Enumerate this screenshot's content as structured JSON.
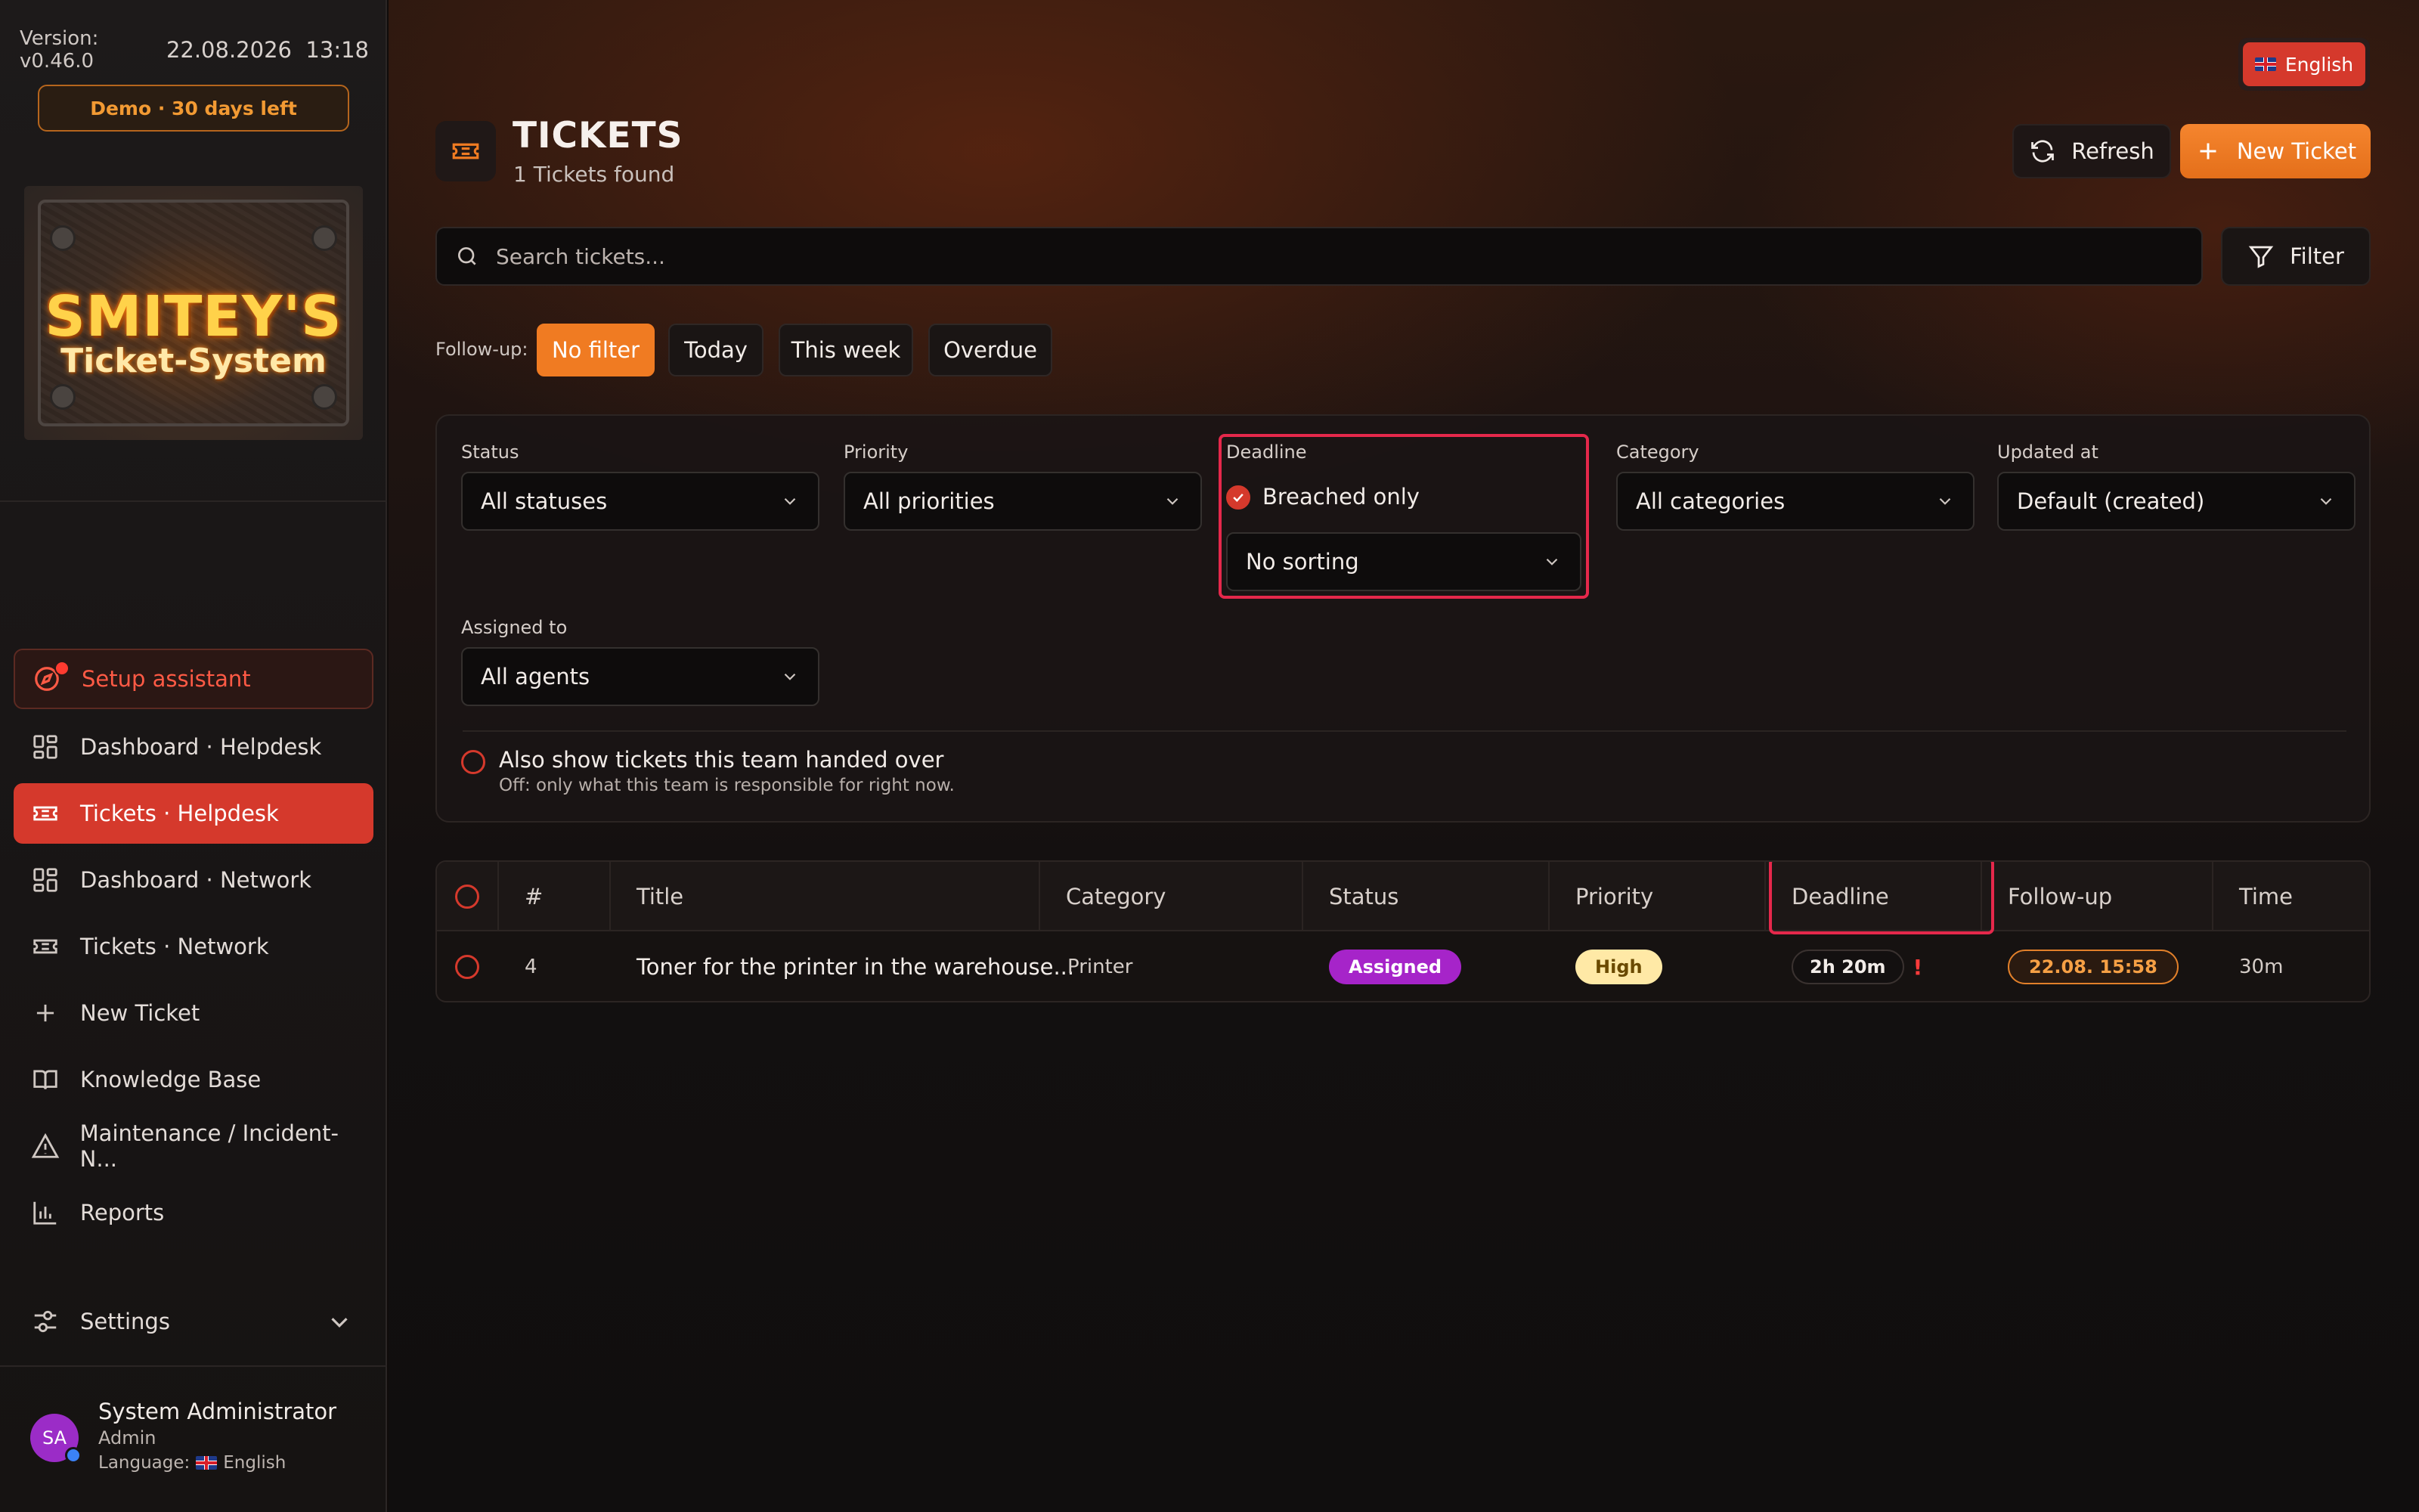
{
  "sidebar": {
    "version": "Version: v0.46.0",
    "date": "22.08.2026",
    "time": "13:18",
    "demo_badge": "Demo · 30 days left",
    "logo": {
      "line1": "SMITEY'S",
      "line2": "Ticket-System"
    },
    "setup": "Setup assistant",
    "items": [
      {
        "label": "Dashboard · Helpdesk",
        "icon": "dashboard-icon"
      },
      {
        "label": "Tickets · Helpdesk",
        "icon": "ticket-icon",
        "active": true
      },
      {
        "label": "Dashboard · Network",
        "icon": "dashboard-icon"
      },
      {
        "label": "Tickets · Network",
        "icon": "ticket-icon"
      },
      {
        "label": "New Ticket",
        "icon": "plus-icon"
      },
      {
        "label": "Knowledge Base",
        "icon": "book-icon"
      },
      {
        "label": "Maintenance / Incident-N...",
        "icon": "warning-icon"
      },
      {
        "label": "Reports",
        "icon": "bar-chart-icon"
      }
    ],
    "settings": "Settings",
    "user": {
      "initials": "SA",
      "name": "System Administrator",
      "role": "Admin",
      "language_label": "Language:",
      "language": "English"
    }
  },
  "header": {
    "language_button": "English",
    "title": "TICKETS",
    "subtitle": "1 Tickets found",
    "refresh": "Refresh",
    "new_ticket": "New Ticket"
  },
  "search": {
    "placeholder": "Search tickets...",
    "value": ""
  },
  "filter_button": "Filter",
  "followup": {
    "label": "Follow-up:",
    "options": [
      "No filter",
      "Today",
      "This week",
      "Overdue"
    ],
    "active": "No filter"
  },
  "filters": {
    "status": {
      "label": "Status",
      "value": "All statuses"
    },
    "priority": {
      "label": "Priority",
      "value": "All priorities"
    },
    "deadline": {
      "label": "Deadline",
      "checkbox": "Breached only",
      "checked": true,
      "sort": "No sorting"
    },
    "category": {
      "label": "Category",
      "value": "All categories"
    },
    "updated": {
      "label": "Updated at",
      "value": "Default (created)"
    },
    "assigned": {
      "label": "Assigned to",
      "value": "All agents"
    },
    "handover": {
      "label": "Also show tickets this team handed over",
      "hint": "Off: only what this team is responsible for right now.",
      "checked": false
    }
  },
  "table": {
    "columns": [
      "#",
      "Title",
      "Category",
      "Status",
      "Priority",
      "Deadline",
      "Follow-up",
      "Time"
    ],
    "rows": [
      {
        "id": "4",
        "title": "Toner for the printer in the warehouse...",
        "category": "Printer",
        "status": "Assigned",
        "priority": "High",
        "deadline": "2h 20m",
        "deadline_flag": "!",
        "followup": "22.08. 15:58",
        "time": "30m"
      }
    ]
  },
  "colors": {
    "accent_red": "#d5392c",
    "accent_orange": "#f07b22",
    "highlight": "#e5284b",
    "status_assigned": "#a624c9",
    "priority_high": "#ffe9a6"
  }
}
